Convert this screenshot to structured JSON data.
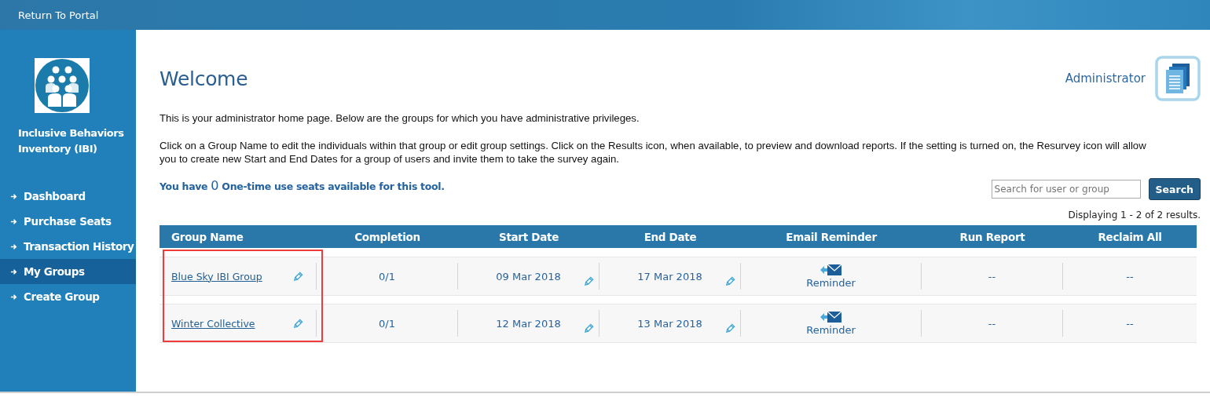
{
  "top_bar": {
    "link": "Return To Portal"
  },
  "sidebar": {
    "app_name": "Inclusive Behaviors Inventory (IBI)",
    "items": [
      {
        "label": "Dashboard",
        "selected": false
      },
      {
        "label": "Purchase Seats",
        "selected": false
      },
      {
        "label": "Transaction History",
        "selected": false
      },
      {
        "label": "My Groups",
        "selected": true
      },
      {
        "label": "Create Group",
        "selected": false
      }
    ]
  },
  "header": {
    "title": "Welcome",
    "role": "Administrator"
  },
  "intro": [
    "This is your administrator home page. Below are the groups for which you have administrative privileges.",
    "Click on a Group Name to edit the individuals within that group or edit group settings. Click on the Results icon, when available, to preview and download reports. If the setting is turned on, the Resurvey icon will allow you to create new Start and End Dates for a group of users and invite them to take the survey again."
  ],
  "seats": {
    "prefix": "You have",
    "count": "0",
    "suffix": "One-time use seats available for this tool."
  },
  "search": {
    "placeholder": "Search for user or group",
    "button": "Search"
  },
  "results_info": "Displaying 1 - 2 of 2 results.",
  "table": {
    "columns": [
      {
        "label": "Group Name",
        "highlighted": true
      },
      {
        "label": "Completion",
        "highlighted": false
      },
      {
        "label": "Start Date",
        "highlighted": false
      },
      {
        "label": "End Date",
        "highlighted": false
      },
      {
        "label": "Email Reminder",
        "highlighted": false
      },
      {
        "label": "Run Report",
        "highlighted": false
      },
      {
        "label": "Reclaim All",
        "highlighted": false
      }
    ],
    "rows": [
      {
        "group_name": "Blue Sky IBI Group",
        "completion": "0/1",
        "start_date": "09 Mar 2018",
        "end_date": "17 Mar 2018",
        "reminder": "Reminder",
        "run_report": "--",
        "reclaim_all": "--"
      },
      {
        "group_name": "Winter Collective",
        "completion": "0/1",
        "start_date": "12 Mar 2018",
        "end_date": "13 Mar 2018",
        "reminder": "Reminder",
        "run_report": "--",
        "reclaim_all": "--"
      }
    ]
  }
}
